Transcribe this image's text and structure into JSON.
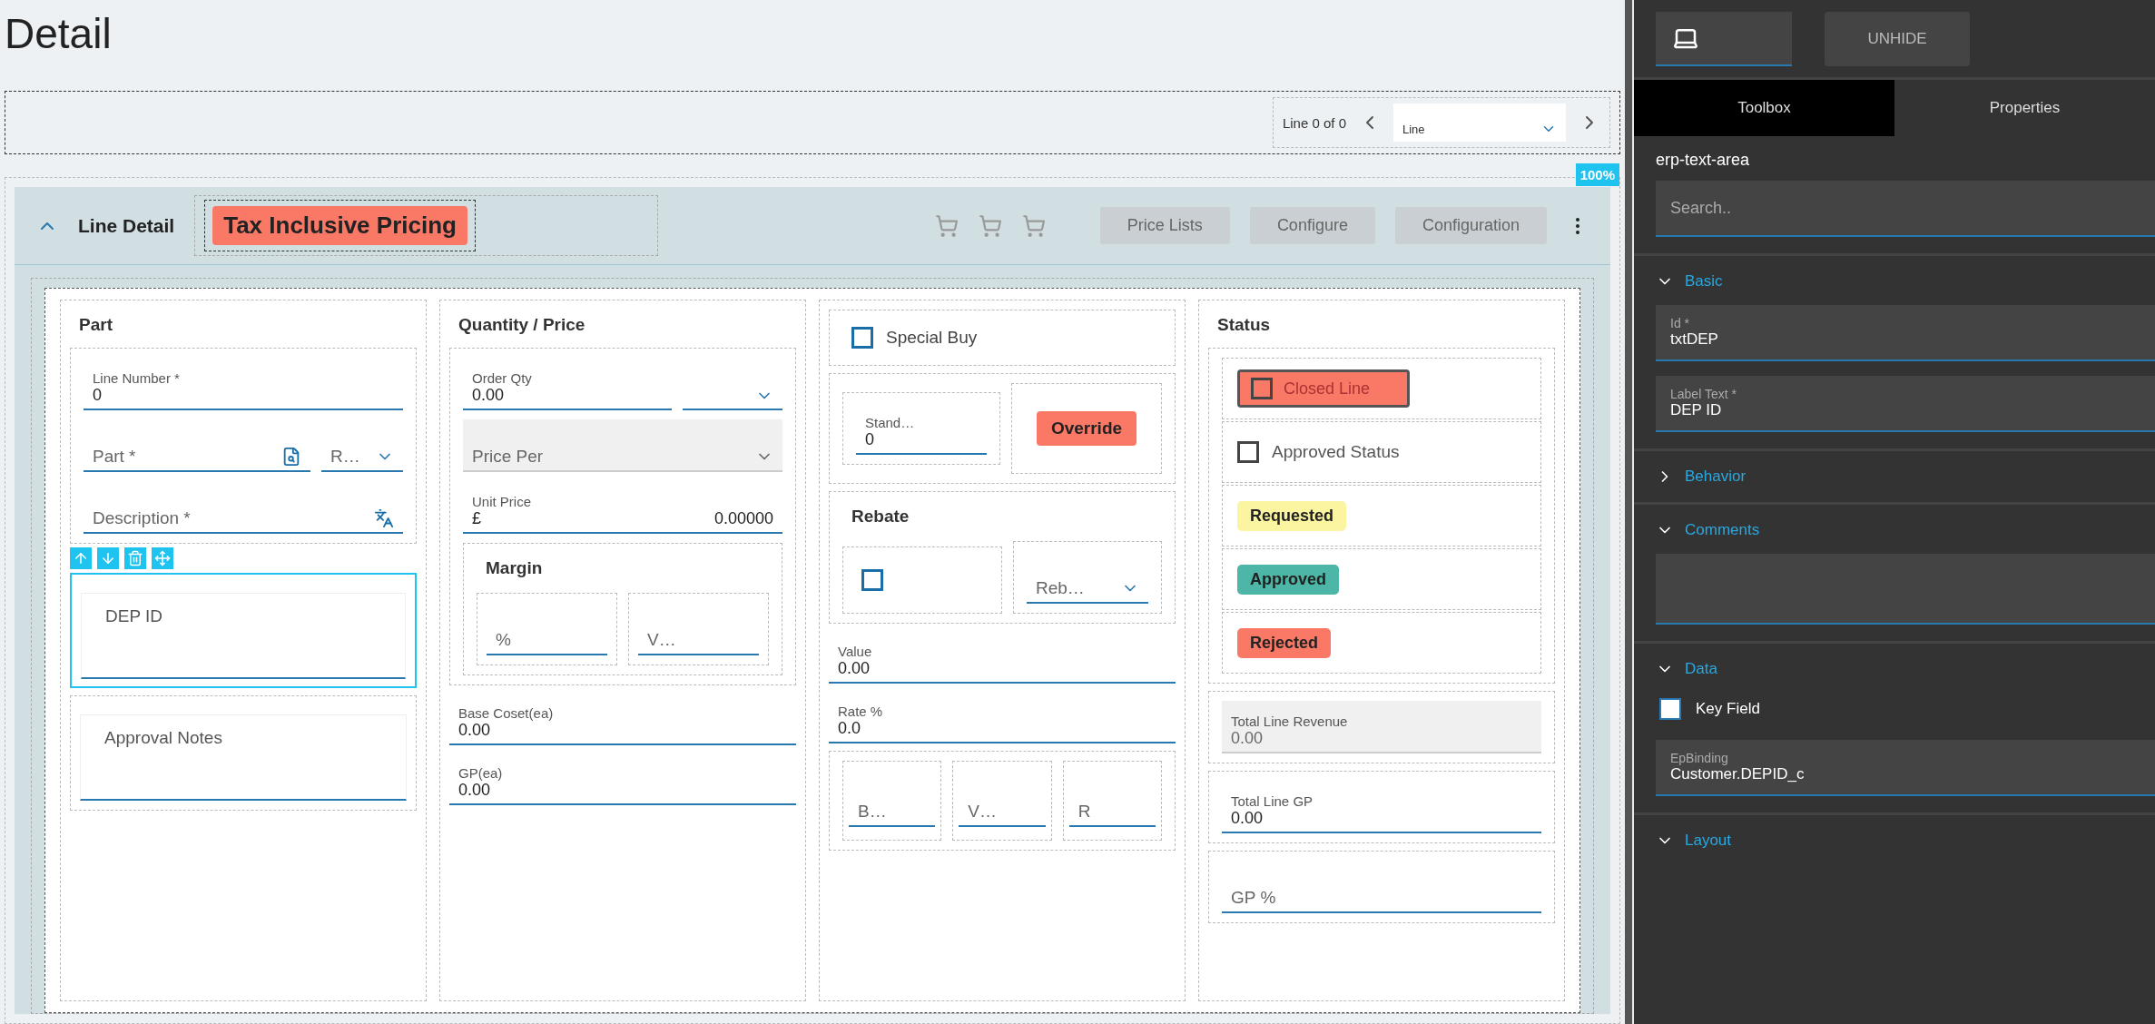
{
  "page": {
    "title": "Detail"
  },
  "pager": {
    "text": "Line 0 of 0",
    "dropdown_value": "Line"
  },
  "zoom_badge": "100%",
  "card": {
    "title": "Line Detail",
    "expanded": true,
    "tag": "Tax Inclusive Pricing",
    "buttons": [
      "Price Lists",
      "Configure",
      "Configuration"
    ]
  },
  "part": {
    "heading": "Part",
    "line_number": {
      "label": "Line Number *",
      "value": "0"
    },
    "part": {
      "placeholder": "Part *"
    },
    "revision": {
      "placeholder": "R…"
    },
    "description": {
      "placeholder": "Description *"
    },
    "dep_id": {
      "placeholder": "DEP ID",
      "selected": true
    },
    "approval_notes": {
      "placeholder": "Approval Notes"
    }
  },
  "quantity_price": {
    "heading": "Quantity / Price",
    "order_qty": {
      "label": "Order Qty",
      "value": "0.00"
    },
    "price_per": {
      "placeholder": "Price Per",
      "disabled": true
    },
    "unit_price": {
      "label": "Unit Price",
      "currency": "£",
      "value": "0.00000"
    },
    "margin": {
      "heading": "Margin",
      "fields": [
        {
          "label": "%"
        },
        {
          "label": "V…"
        }
      ]
    },
    "base_cost": {
      "label": "Base Coset(ea)",
      "value": "0.00"
    },
    "gp_each": {
      "label": "GP(ea)",
      "value": "0.00"
    }
  },
  "special": {
    "special_buy": {
      "label": "Special Buy",
      "checked": false
    },
    "standard": {
      "label": "Stand…",
      "value": "0"
    },
    "override_button": "Override",
    "rebate": {
      "heading": "Rebate",
      "checked": false,
      "dropdown": "Reb…"
    },
    "value": {
      "label": "Value",
      "value": "0.00"
    },
    "rate": {
      "label": "Rate %",
      "value": "0.0"
    },
    "small_fields": [
      {
        "label": "B…"
      },
      {
        "label": "V…"
      },
      {
        "label": "R"
      }
    ]
  },
  "status": {
    "heading": "Status",
    "closed_line": {
      "label": "Closed Line",
      "checked": false
    },
    "approved_status": {
      "label": "Approved Status",
      "checked": false
    },
    "badges": [
      {
        "label": "Requested",
        "color": "#fbf4a0"
      },
      {
        "label": "Approved",
        "color": "#4db6a6"
      },
      {
        "label": "Rejected",
        "color": "#fa7866"
      }
    ],
    "total_line_revenue": {
      "label": "Total Line Revenue",
      "value": "0.00",
      "disabled": true
    },
    "total_line_gp": {
      "label": "Total Line GP",
      "value": "0.00"
    },
    "gp_percent": {
      "placeholder": "GP %"
    }
  },
  "panel": {
    "unhide_button": "UNHIDE",
    "tabs": [
      {
        "label": "Toolbox",
        "selected": false
      },
      {
        "label": "Properties",
        "selected": true
      }
    ],
    "component": "erp-text-area",
    "search": {
      "placeholder": "Search.."
    },
    "sections": [
      {
        "kind": "fields",
        "title": "Basic",
        "expanded": true,
        "fields": [
          {
            "label": "Id *",
            "value": "txtDEP"
          },
          {
            "label": "Label Text *",
            "value": "DEP ID"
          }
        ]
      },
      {
        "title": "Behavior",
        "expanded": false
      },
      {
        "kind": "textarea",
        "title": "Comments",
        "expanded": true
      },
      {
        "kind": "data",
        "title": "Data",
        "expanded": true,
        "checkbox": {
          "label": "Key Field",
          "checked": false
        },
        "fields": [
          {
            "label": "EpBinding",
            "value": "Customer.DEPID_c"
          }
        ]
      },
      {
        "title": "Layout",
        "expanded": true
      }
    ]
  }
}
